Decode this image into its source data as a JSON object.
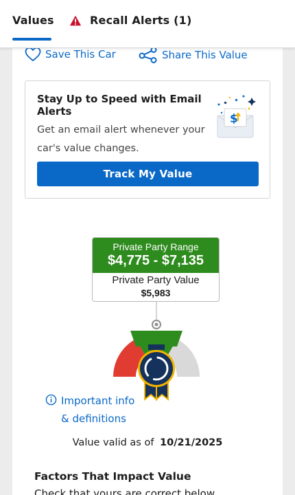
{
  "tabs": {
    "values_label": "Values",
    "recall_label": "Recall Alerts (1)"
  },
  "actions": {
    "save_label": "Save This Car",
    "share_label": "Share This Value"
  },
  "email_alert": {
    "title": "Stay Up to Speed with Email Alerts",
    "description": "Get an email alert whenever your car's value changes.",
    "button_label": "Track My Value"
  },
  "valuation": {
    "range_label": "Private Party Range",
    "range_value": "$4,775 - $7,135",
    "value_label": "Private Party Value",
    "value": "$5,983"
  },
  "info": {
    "label": "Important info & definitions"
  },
  "valid": {
    "prefix": "Value valid as of",
    "date": "10/21/2025"
  },
  "factors": {
    "title": "Factors That Impact Value",
    "subtitle": "Check that yours are correct below."
  },
  "colors": {
    "accent": "#0a68c7",
    "range_green": "#2e8b1d",
    "gauge_red": "#e03c31",
    "gauge_grey": "#d9d9d9",
    "badge_navy": "#14325c",
    "badge_gold": "#f4b400"
  },
  "icons": {
    "recall": "warning-triangle-icon",
    "save": "heart-icon",
    "share": "share-icon",
    "email": "envelope-icon",
    "info": "info-icon"
  }
}
